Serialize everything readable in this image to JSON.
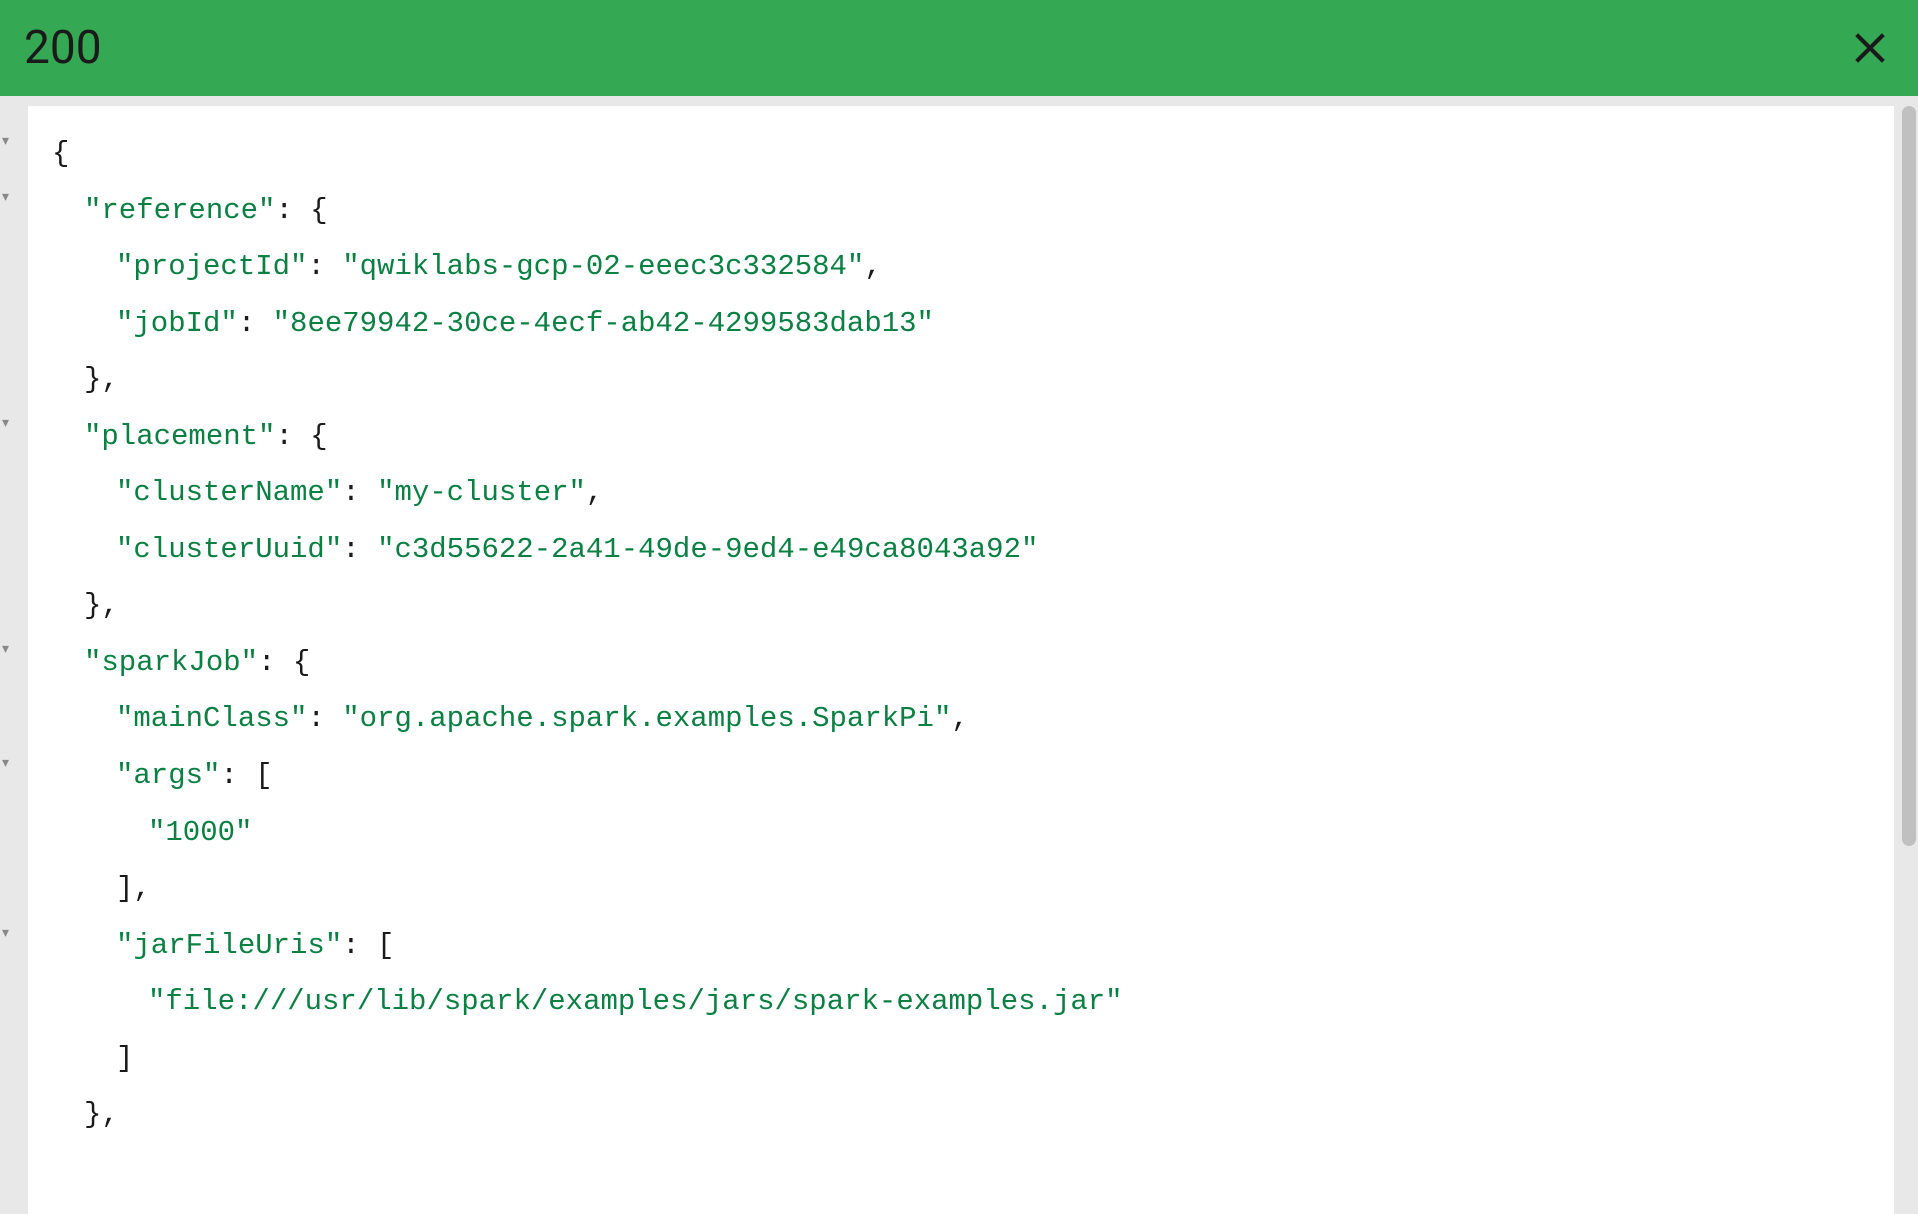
{
  "header": {
    "status_code": "200"
  },
  "json_response": {
    "reference": {
      "projectId": "qwiklabs-gcp-02-eeec3c332584",
      "jobId": "8ee79942-30ce-4ecf-ab42-4299583dab13"
    },
    "placement": {
      "clusterName": "my-cluster",
      "clusterUuid": "c3d55622-2a41-49de-9ed4-e49ca8043a92"
    },
    "sparkJob": {
      "mainClass": "org.apache.spark.examples.SparkPi",
      "args": [
        "1000"
      ],
      "jarFileUris": [
        "file:///usr/lib/spark/examples/jars/spark-examples.jar"
      ]
    }
  },
  "labels": {
    "key_reference": "\"reference\"",
    "key_projectId": "\"projectId\"",
    "val_projectId": "\"qwiklabs-gcp-02-eeec3c332584\"",
    "key_jobId": "\"jobId\"",
    "val_jobId": "\"8ee79942-30ce-4ecf-ab42-4299583dab13\"",
    "key_placement": "\"placement\"",
    "key_clusterName": "\"clusterName\"",
    "val_clusterName": "\"my-cluster\"",
    "key_clusterUuid": "\"clusterUuid\"",
    "val_clusterUuid": "\"c3d55622-2a41-49de-9ed4-e49ca8043a92\"",
    "key_sparkJob": "\"sparkJob\"",
    "key_mainClass": "\"mainClass\"",
    "val_mainClass": "\"org.apache.spark.examples.SparkPi\"",
    "key_args": "\"args\"",
    "val_args_0": "\"1000\"",
    "key_jarFileUris": "\"jarFileUris\"",
    "val_jarFileUris_0": "\"file:///usr/lib/spark/examples/jars/spark-examples.jar\""
  }
}
